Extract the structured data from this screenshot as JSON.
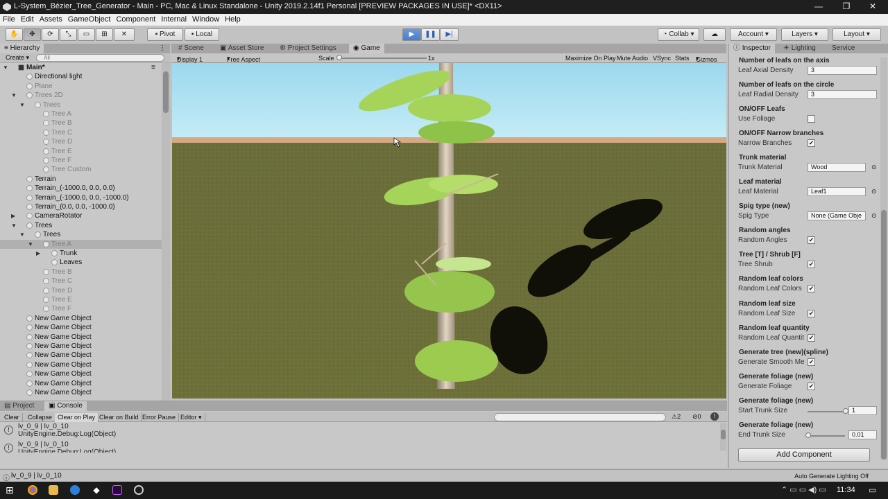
{
  "window": {
    "title": "L-System_Bézier_Tree_Generator - Main - PC, Mac & Linux Standalone - Unity 2019.2.14f1 Personal [PREVIEW PACKAGES IN USE]* <DX11>",
    "min": "—",
    "max": "❐",
    "close": "✕"
  },
  "menu": [
    "File",
    "Edit",
    "Assets",
    "GameObject",
    "Component",
    "Internal",
    "Window",
    "Help"
  ],
  "toolbar": {
    "pivot": "Pivot",
    "local": "Local",
    "collab": "Collab",
    "account": "Account",
    "layers": "Layers",
    "layout": "Layout"
  },
  "hierarchy": {
    "tab": "Hierarchy",
    "create": "Create",
    "search_placeholder": "All",
    "rows": [
      {
        "label": "Main*",
        "indent": 0,
        "arrow": "▼",
        "dim": false,
        "scene": true
      },
      {
        "label": "Directional light",
        "indent": 1,
        "arrow": "",
        "dim": false
      },
      {
        "label": "Plane",
        "indent": 1,
        "arrow": "",
        "dim": true
      },
      {
        "label": "Trees 2D",
        "indent": 1,
        "arrow": "▼",
        "dim": true
      },
      {
        "label": "Trees",
        "indent": 2,
        "arrow": "▼",
        "dim": true
      },
      {
        "label": "Tree A",
        "indent": 3,
        "arrow": "",
        "dim": true
      },
      {
        "label": "Tree B",
        "indent": 3,
        "arrow": "",
        "dim": true
      },
      {
        "label": "Tree C",
        "indent": 3,
        "arrow": "",
        "dim": true
      },
      {
        "label": "Tree D",
        "indent": 3,
        "arrow": "",
        "dim": true
      },
      {
        "label": "Tree E",
        "indent": 3,
        "arrow": "",
        "dim": true
      },
      {
        "label": "Tree F",
        "indent": 3,
        "arrow": "",
        "dim": true
      },
      {
        "label": "Tree Custom",
        "indent": 3,
        "arrow": "",
        "dim": true
      },
      {
        "label": "Terrain",
        "indent": 1,
        "arrow": "",
        "dim": false
      },
      {
        "label": "Terrain_(-1000.0, 0.0, 0.0)",
        "indent": 1,
        "arrow": "",
        "dim": false
      },
      {
        "label": "Terrain_(-1000.0, 0.0, -1000.0)",
        "indent": 1,
        "arrow": "",
        "dim": false
      },
      {
        "label": "Terrain_(0.0, 0.0, -1000.0)",
        "indent": 1,
        "arrow": "",
        "dim": false
      },
      {
        "label": "CameraRotator",
        "indent": 1,
        "arrow": "▶",
        "dim": false
      },
      {
        "label": "Trees",
        "indent": 1,
        "arrow": "▼",
        "dim": false
      },
      {
        "label": "Trees",
        "indent": 2,
        "arrow": "▼",
        "dim": false
      },
      {
        "label": "Tree A",
        "indent": 3,
        "arrow": "▼",
        "dim": true,
        "selected": true
      },
      {
        "label": "Trunk",
        "indent": 4,
        "arrow": "▶",
        "dim": false
      },
      {
        "label": "Leaves",
        "indent": 4,
        "arrow": "",
        "dim": false
      },
      {
        "label": "Tree B",
        "indent": 3,
        "arrow": "",
        "dim": true
      },
      {
        "label": "Tree C",
        "indent": 3,
        "arrow": "",
        "dim": true
      },
      {
        "label": "Tree D",
        "indent": 3,
        "arrow": "",
        "dim": true
      },
      {
        "label": "Tree E",
        "indent": 3,
        "arrow": "",
        "dim": true
      },
      {
        "label": "Tree F",
        "indent": 3,
        "arrow": "",
        "dim": true
      },
      {
        "label": "New Game Object",
        "indent": 1,
        "arrow": "",
        "dim": false
      },
      {
        "label": "New Game Object",
        "indent": 1,
        "arrow": "",
        "dim": false
      },
      {
        "label": "New Game Object",
        "indent": 1,
        "arrow": "",
        "dim": false
      },
      {
        "label": "New Game Object",
        "indent": 1,
        "arrow": "",
        "dim": false
      },
      {
        "label": "New Game Object",
        "indent": 1,
        "arrow": "",
        "dim": false
      },
      {
        "label": "New Game Object",
        "indent": 1,
        "arrow": "",
        "dim": false
      },
      {
        "label": "New Game Object",
        "indent": 1,
        "arrow": "",
        "dim": false
      },
      {
        "label": "New Game Object",
        "indent": 1,
        "arrow": "",
        "dim": false
      },
      {
        "label": "New Game Object",
        "indent": 1,
        "arrow": "",
        "dim": false
      }
    ]
  },
  "center_tabs": {
    "scene": "Scene",
    "asset_store": "Asset Store",
    "project_settings": "Project Settings",
    "game": "Game"
  },
  "game_bar": {
    "display": "Display 1",
    "aspect": "Free Aspect",
    "scale_label": "Scale",
    "scale_value": "1x",
    "maximize": "Maximize On Play",
    "mute": "Mute Audio",
    "vsync": "VSync",
    "stats": "Stats",
    "gizmos": "Gizmos"
  },
  "inspector": {
    "tabs": {
      "inspector": "Inspector",
      "lighting": "Lighting",
      "services": "Service"
    },
    "items": [
      {
        "header": "Number of leafs on the axis",
        "label": "Leaf Axial Density",
        "kind": "field",
        "value": "3"
      },
      {
        "header": "Number of leafs on the circle",
        "label": "Leaf Radial Density",
        "kind": "field",
        "value": "3"
      },
      {
        "header": "ON/OFF Leafs",
        "label": "Use Foliage",
        "kind": "check",
        "value": ""
      },
      {
        "header": "ON/OFF Narrow branches",
        "label": "Narrow Branches",
        "kind": "check",
        "value": "✔"
      },
      {
        "header": "Trunk material",
        "label": "Trunk Material",
        "kind": "object",
        "value": "Wood"
      },
      {
        "header": "Leaf material",
        "label": "Leaf Material",
        "kind": "object",
        "value": "Leaf1"
      },
      {
        "header": "Spig type (new)",
        "label": "Spig Type",
        "kind": "object",
        "value": "None (Game Obje"
      },
      {
        "header": "Random angles",
        "label": "Random Angles",
        "kind": "check",
        "value": "✔"
      },
      {
        "header": "Tree [T] / Shrub [F]",
        "label": "Tree Shrub",
        "kind": "check",
        "value": "✔"
      },
      {
        "header": "Random leaf colors",
        "label": "Random Leaf Colors",
        "kind": "check",
        "value": "✔"
      },
      {
        "header": "Random leaf size",
        "label": "Random Leaf Size",
        "kind": "check",
        "value": "✔"
      },
      {
        "header": "Random leaf quantity",
        "label": "Random Leaf Quantit",
        "kind": "check",
        "value": "✔"
      },
      {
        "header": "Generate tree (new)(spline)",
        "label": "Generate Smooth Me",
        "kind": "check",
        "value": "✔"
      },
      {
        "header": "Generate foliage (new)",
        "label": "Generate Foliage",
        "kind": "check",
        "value": "✔"
      },
      {
        "header": "Generate foliage (new)",
        "label": "Start Trunk Size",
        "kind": "slider",
        "value": "1",
        "fraction": 1.0
      },
      {
        "header": "Generate foliage (new)",
        "label": "End Trunk Size",
        "kind": "slider",
        "value": "0.01",
        "fraction": 0.0
      }
    ],
    "add_component": "Add Component"
  },
  "console": {
    "tabs": {
      "project": "Project",
      "console": "Console"
    },
    "buttons": [
      "Clear",
      "Collapse",
      "Clear on Play",
      "Clear on Build",
      "Error Pause",
      "Editor"
    ],
    "counts": {
      "warnings": "2",
      "errors": "0"
    },
    "messages": [
      {
        "line1": "lv_0_9 | lv_0_10",
        "line2": "UnityEngine.Debug:Log(Object)"
      },
      {
        "line1": "lv_0_9 | lv_0_10",
        "line2": "UnityEngine.Debug:Log(Object)"
      }
    ]
  },
  "status": {
    "left": "lv_0_9 | lv_0_10",
    "right": "Auto Generate Lighting Off"
  },
  "taskbar": {
    "time": "11:34"
  }
}
